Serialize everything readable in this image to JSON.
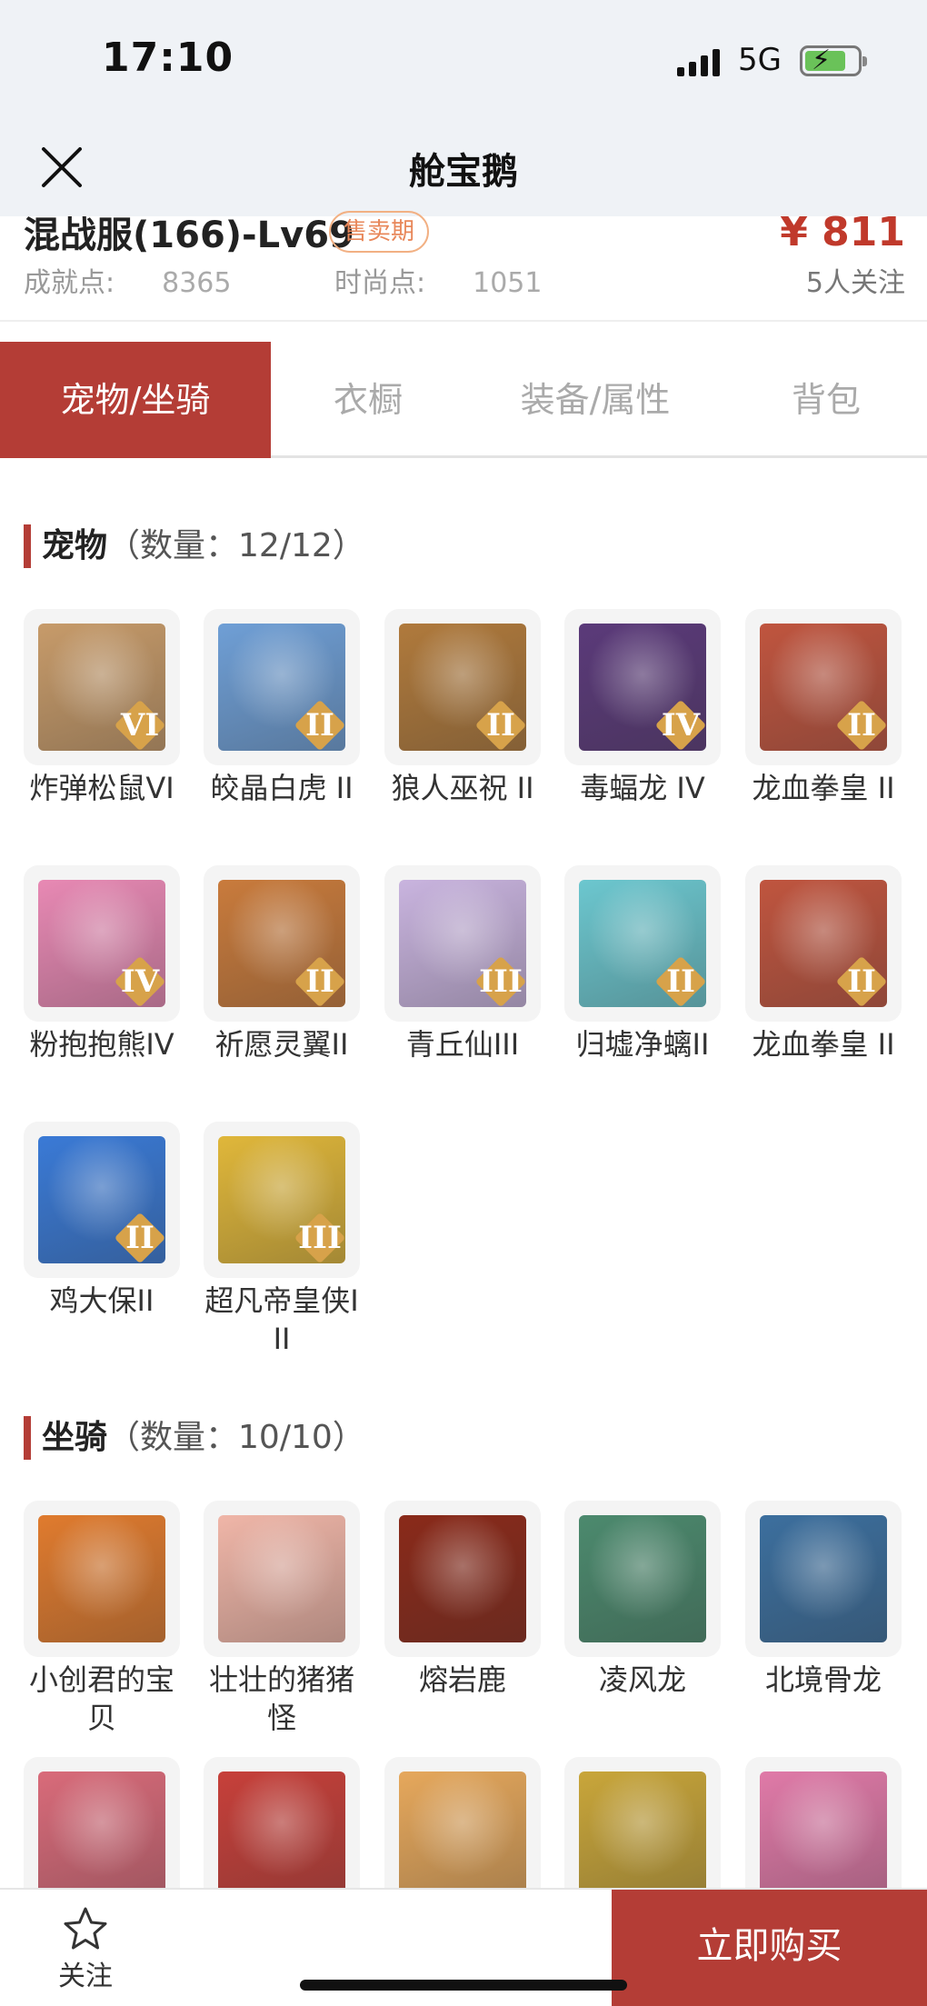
{
  "status": {
    "time": "17:10",
    "network": "5G"
  },
  "nav": {
    "title": "舱宝鹅"
  },
  "info": {
    "server": "混战服(166)-Lv69",
    "badge": "售卖期",
    "achievement_label": "成就点:",
    "achievement_value": "8365",
    "fashion_label": "时尚点:",
    "fashion_value": "1051",
    "price": "¥ 811",
    "followers": "5人关注"
  },
  "tabs": [
    {
      "label": "宠物/坐骑",
      "active": true
    },
    {
      "label": "衣橱",
      "active": false
    },
    {
      "label": "装备/属性",
      "active": false
    },
    {
      "label": "背包",
      "active": false
    }
  ],
  "pets": {
    "title": "宠物",
    "count": "（数量：12/12）",
    "items": [
      {
        "name": "炸弹松鼠VI",
        "rank": "VI",
        "color": "#c79b6a"
      },
      {
        "name": "皎晶白虎 II",
        "rank": "II",
        "color": "#6f9fd6"
      },
      {
        "name": "狼人巫祝 II",
        "rank": "II",
        "color": "#b07a3c"
      },
      {
        "name": "毒蝠龙 IV",
        "rank": "IV",
        "color": "#5b3a7a"
      },
      {
        "name": "龙血拳皇 II",
        "rank": "II",
        "color": "#c0553f"
      },
      {
        "name": "粉抱抱熊IV",
        "rank": "IV",
        "color": "#e889b4"
      },
      {
        "name": "祈愿灵翼II",
        "rank": "II",
        "color": "#c97b3c"
      },
      {
        "name": "青丘仙III",
        "rank": "III",
        "color": "#c9b4df"
      },
      {
        "name": "归墟净螭II",
        "rank": "II",
        "color": "#6cc7cf"
      },
      {
        "name": "龙血拳皇 II",
        "rank": "II",
        "color": "#c0553f"
      },
      {
        "name": "鸡大保II",
        "rank": "II",
        "color": "#3a7ad6"
      },
      {
        "name": "超凡帝皇侠III",
        "rank": "III",
        "color": "#e0b73a"
      }
    ]
  },
  "mounts": {
    "title": "坐骑",
    "count": "（数量：10/10）",
    "items": [
      {
        "name": "小创君的宝贝",
        "color": "#e07b2e"
      },
      {
        "name": "壮壮的猪猪怪",
        "color": "#f0b6a8"
      },
      {
        "name": "熔岩鹿",
        "color": "#8a2a1a"
      },
      {
        "name": "凌风龙",
        "color": "#4c8a6e"
      },
      {
        "name": "北境骨龙",
        "color": "#3c6f9e"
      },
      {
        "name": "",
        "color": "#d96b7a"
      },
      {
        "name": "",
        "color": "#c7403a"
      },
      {
        "name": "",
        "color": "#e6a85c"
      },
      {
        "name": "",
        "color": "#c9a63a"
      },
      {
        "name": "",
        "color": "#e07aa8"
      }
    ]
  },
  "bottom": {
    "follow_label": "关注",
    "buy_label": "立即购买"
  },
  "colors": {
    "accent": "#b43d36",
    "price": "#c0392b",
    "badge": "#e8875a"
  }
}
